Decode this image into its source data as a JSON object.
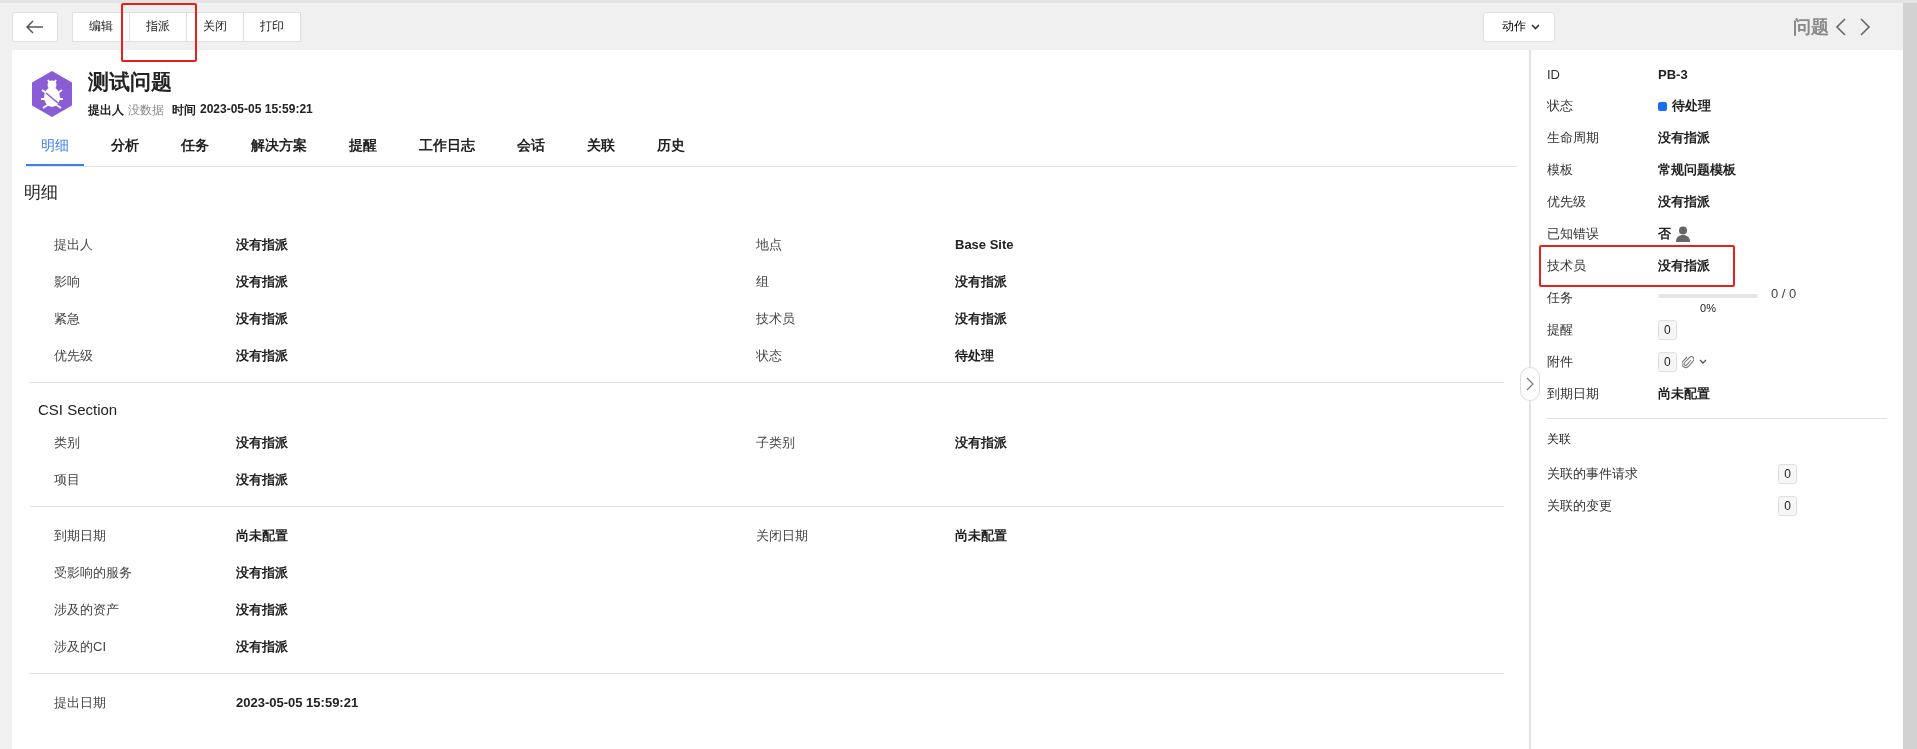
{
  "toolbar": {
    "buttons": [
      {
        "label": "编辑",
        "highlighted": false
      },
      {
        "label": "指派",
        "highlighted": true
      },
      {
        "label": "关闭",
        "highlighted": false
      },
      {
        "label": "打印",
        "highlighted": false
      }
    ],
    "action_menu": {
      "label": "动作"
    }
  },
  "record_nav": {
    "title": "问题"
  },
  "header": {
    "title": "测试问题",
    "meta": [
      {
        "label": "提出人",
        "value": "没数据"
      },
      {
        "label": "时间",
        "value": "2023-05-05 15:59:21"
      }
    ]
  },
  "tabs": [
    {
      "label": "明细",
      "selected": true
    },
    {
      "label": "分析",
      "selected": false
    },
    {
      "label": "任务",
      "selected": false
    },
    {
      "label": "解决方案",
      "selected": false
    },
    {
      "label": "提醒",
      "selected": false
    },
    {
      "label": "工作日志",
      "selected": false
    },
    {
      "label": "会话",
      "selected": false
    },
    {
      "label": "关联",
      "selected": false
    },
    {
      "label": "历史",
      "selected": false
    }
  ],
  "details": {
    "heading": "明细",
    "sections": [
      {
        "rows": [
          [
            {
              "label": "提出人",
              "value": "没有指派"
            },
            {
              "label": "地点",
              "value": "Base Site"
            }
          ],
          [
            {
              "label": "影响",
              "value": "没有指派"
            },
            {
              "label": "组",
              "value": "没有指派"
            }
          ],
          [
            {
              "label": "紧急",
              "value": "没有指派"
            },
            {
              "label": "技术员",
              "value": "没有指派"
            }
          ],
          [
            {
              "label": "优先级",
              "value": "没有指派"
            },
            {
              "label": "状态",
              "value": "待处理"
            }
          ]
        ]
      },
      {
        "title": "CSI Section",
        "rows": [
          [
            {
              "label": "类别",
              "value": "没有指派"
            },
            {
              "label": "子类别",
              "value": "没有指派"
            }
          ],
          [
            {
              "label": "项目",
              "value": "没有指派"
            }
          ]
        ]
      },
      {
        "rows": [
          [
            {
              "label": "到期日期",
              "value": "尚未配置"
            },
            {
              "label": "关闭日期",
              "value": "尚未配置"
            }
          ],
          [
            {
              "label": "受影响的服务",
              "value": "没有指派"
            }
          ],
          [
            {
              "label": "涉及的资产",
              "value": "没有指派"
            }
          ],
          [
            {
              "label": "涉及的CI",
              "value": "没有指派"
            }
          ]
        ]
      },
      {
        "rows": [
          [
            {
              "label": "提出日期",
              "value": "2023-05-05 15:59:21"
            }
          ]
        ]
      }
    ]
  },
  "side_panel": {
    "properties": [
      {
        "kind": "text",
        "label": "ID",
        "value": "PB-3",
        "highlighted": false
      },
      {
        "kind": "status",
        "label": "状态",
        "value": "待处理",
        "color": "#1a6cf5",
        "highlighted": false
      },
      {
        "kind": "text",
        "label": "生命周期",
        "value": "没有指派",
        "highlighted": false
      },
      {
        "kind": "text",
        "label": "模板",
        "value": "常规问题模板",
        "highlighted": false
      },
      {
        "kind": "text",
        "label": "优先级",
        "value": "没有指派",
        "highlighted": false
      },
      {
        "kind": "user",
        "label": "已知错误",
        "value": "否",
        "highlighted": false
      },
      {
        "kind": "text",
        "label": "技术员",
        "value": "没有指派",
        "highlighted": true
      },
      {
        "kind": "progress",
        "label": "任务",
        "level": 0,
        "reading": "0 / 0",
        "percent": "0%",
        "highlighted": false
      },
      {
        "kind": "count",
        "label": "提醒",
        "value": "0",
        "highlighted": false
      },
      {
        "kind": "attachment",
        "label": "附件",
        "value": "0",
        "highlighted": false
      },
      {
        "kind": "text",
        "label": "到期日期",
        "value": "尚未配置",
        "highlighted": false
      }
    ],
    "related": {
      "heading": "关联",
      "items": [
        {
          "label": "关联的事件请求",
          "count": "0"
        },
        {
          "label": "关联的变更",
          "count": "0"
        }
      ]
    }
  }
}
